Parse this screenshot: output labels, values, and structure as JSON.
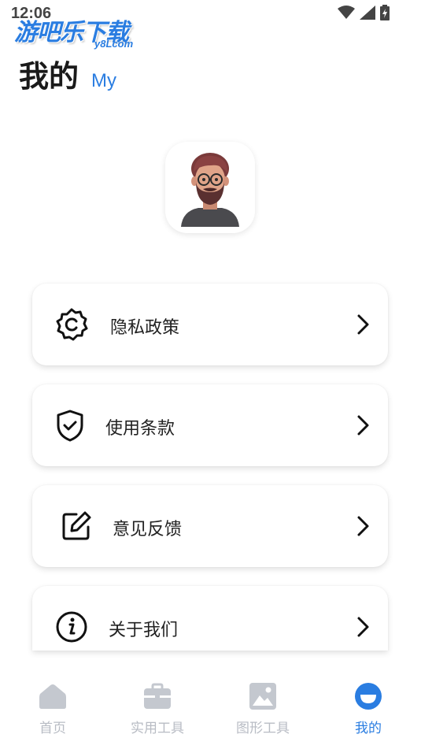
{
  "status_bar": {
    "time": "12:06"
  },
  "watermark": {
    "main": "游吧乐下载",
    "sub": "y8Lcom"
  },
  "header": {
    "title": "我的",
    "subtitle": "My"
  },
  "menu": {
    "items": [
      {
        "label": "隐私政策",
        "icon": "gear-icon"
      },
      {
        "label": "使用条款",
        "icon": "shield-check-icon"
      },
      {
        "label": "意见反馈",
        "icon": "edit-icon"
      },
      {
        "label": "关于我们",
        "icon": "info-icon"
      }
    ]
  },
  "bottom_nav": {
    "items": [
      {
        "label": "首页",
        "icon": "home-icon",
        "active": false
      },
      {
        "label": "实用工具",
        "icon": "briefcase-icon",
        "active": false
      },
      {
        "label": "图形工具",
        "icon": "image-icon",
        "active": false
      },
      {
        "label": "我的",
        "icon": "profile-icon",
        "active": true
      }
    ]
  },
  "colors": {
    "accent": "#2a7de1",
    "inactive": "#b8bcc4",
    "text": "#222222"
  }
}
